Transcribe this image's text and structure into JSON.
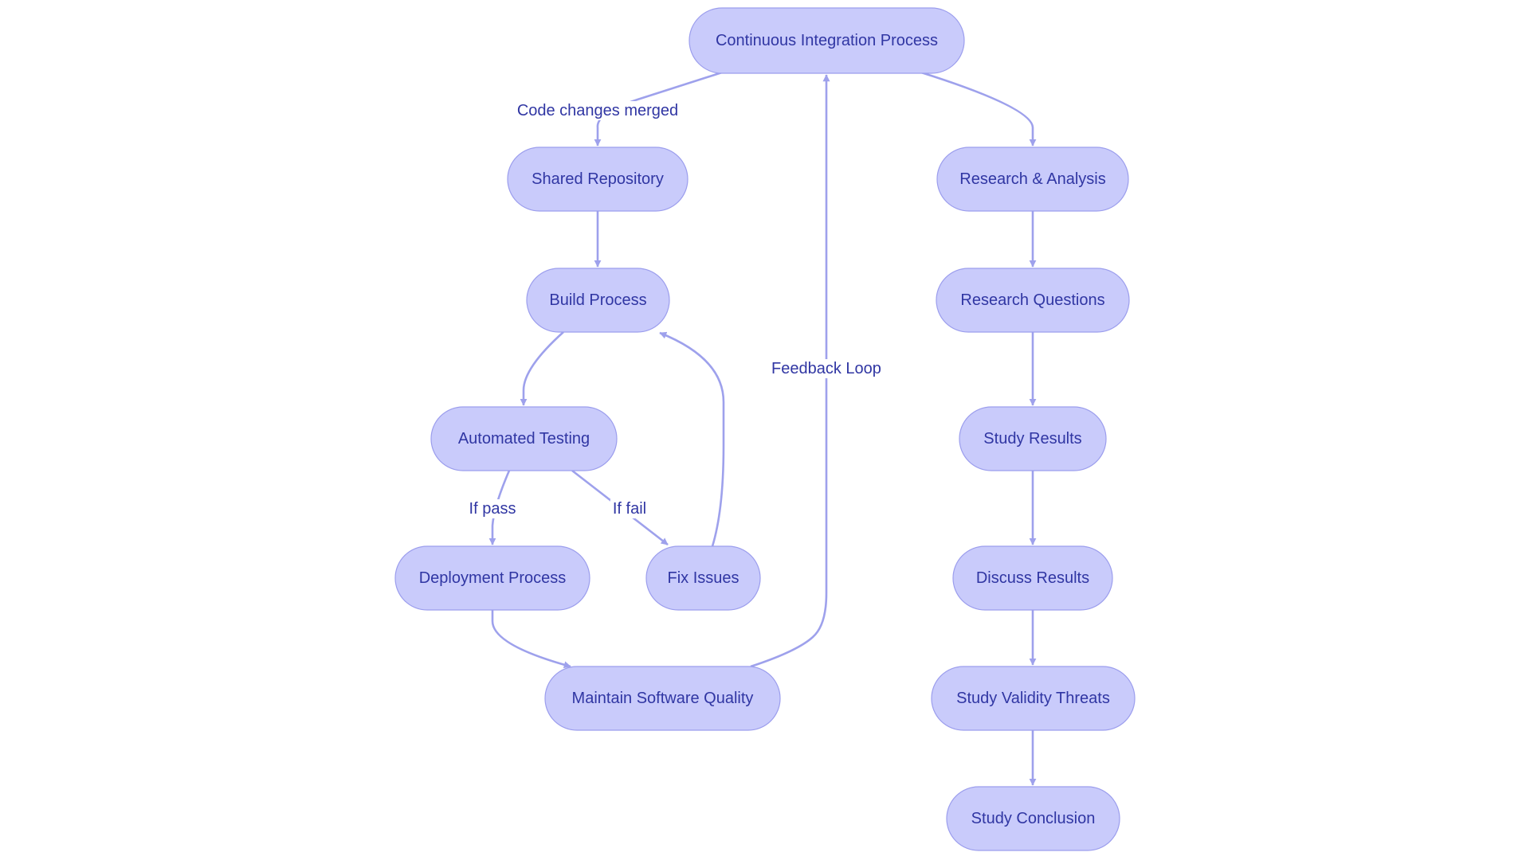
{
  "diagram": {
    "type": "flowchart",
    "colors": {
      "node_fill": "#c9cbfb",
      "node_stroke": "#9c9eed",
      "edge": "#9ea1ec",
      "text": "#3036a3",
      "background": "#ffffff"
    },
    "nodes": [
      {
        "id": "ci",
        "label": "Continuous Integration Process"
      },
      {
        "id": "repo",
        "label": "Shared Repository"
      },
      {
        "id": "build",
        "label": "Build Process"
      },
      {
        "id": "test",
        "label": "Automated Testing"
      },
      {
        "id": "deploy",
        "label": "Deployment Process"
      },
      {
        "id": "fix",
        "label": "Fix Issues"
      },
      {
        "id": "quality",
        "label": "Maintain Software Quality"
      },
      {
        "id": "research",
        "label": "Research & Analysis"
      },
      {
        "id": "questions",
        "label": "Research Questions"
      },
      {
        "id": "results",
        "label": "Study Results"
      },
      {
        "id": "discuss",
        "label": "Discuss Results"
      },
      {
        "id": "threats",
        "label": "Study Validity Threats"
      },
      {
        "id": "conclusion",
        "label": "Study Conclusion"
      }
    ],
    "edges": [
      {
        "from": "ci",
        "to": "repo",
        "label": "Code changes merged"
      },
      {
        "from": "repo",
        "to": "build",
        "label": ""
      },
      {
        "from": "build",
        "to": "test",
        "label": ""
      },
      {
        "from": "test",
        "to": "deploy",
        "label": "If pass"
      },
      {
        "from": "test",
        "to": "fix",
        "label": "If fail"
      },
      {
        "from": "fix",
        "to": "build",
        "label": ""
      },
      {
        "from": "deploy",
        "to": "quality",
        "label": ""
      },
      {
        "from": "quality",
        "to": "ci",
        "label": "Feedback Loop"
      },
      {
        "from": "ci",
        "to": "research",
        "label": ""
      },
      {
        "from": "research",
        "to": "questions",
        "label": ""
      },
      {
        "from": "questions",
        "to": "results",
        "label": ""
      },
      {
        "from": "results",
        "to": "discuss",
        "label": ""
      },
      {
        "from": "discuss",
        "to": "threats",
        "label": ""
      },
      {
        "from": "threats",
        "to": "conclusion",
        "label": ""
      }
    ]
  }
}
